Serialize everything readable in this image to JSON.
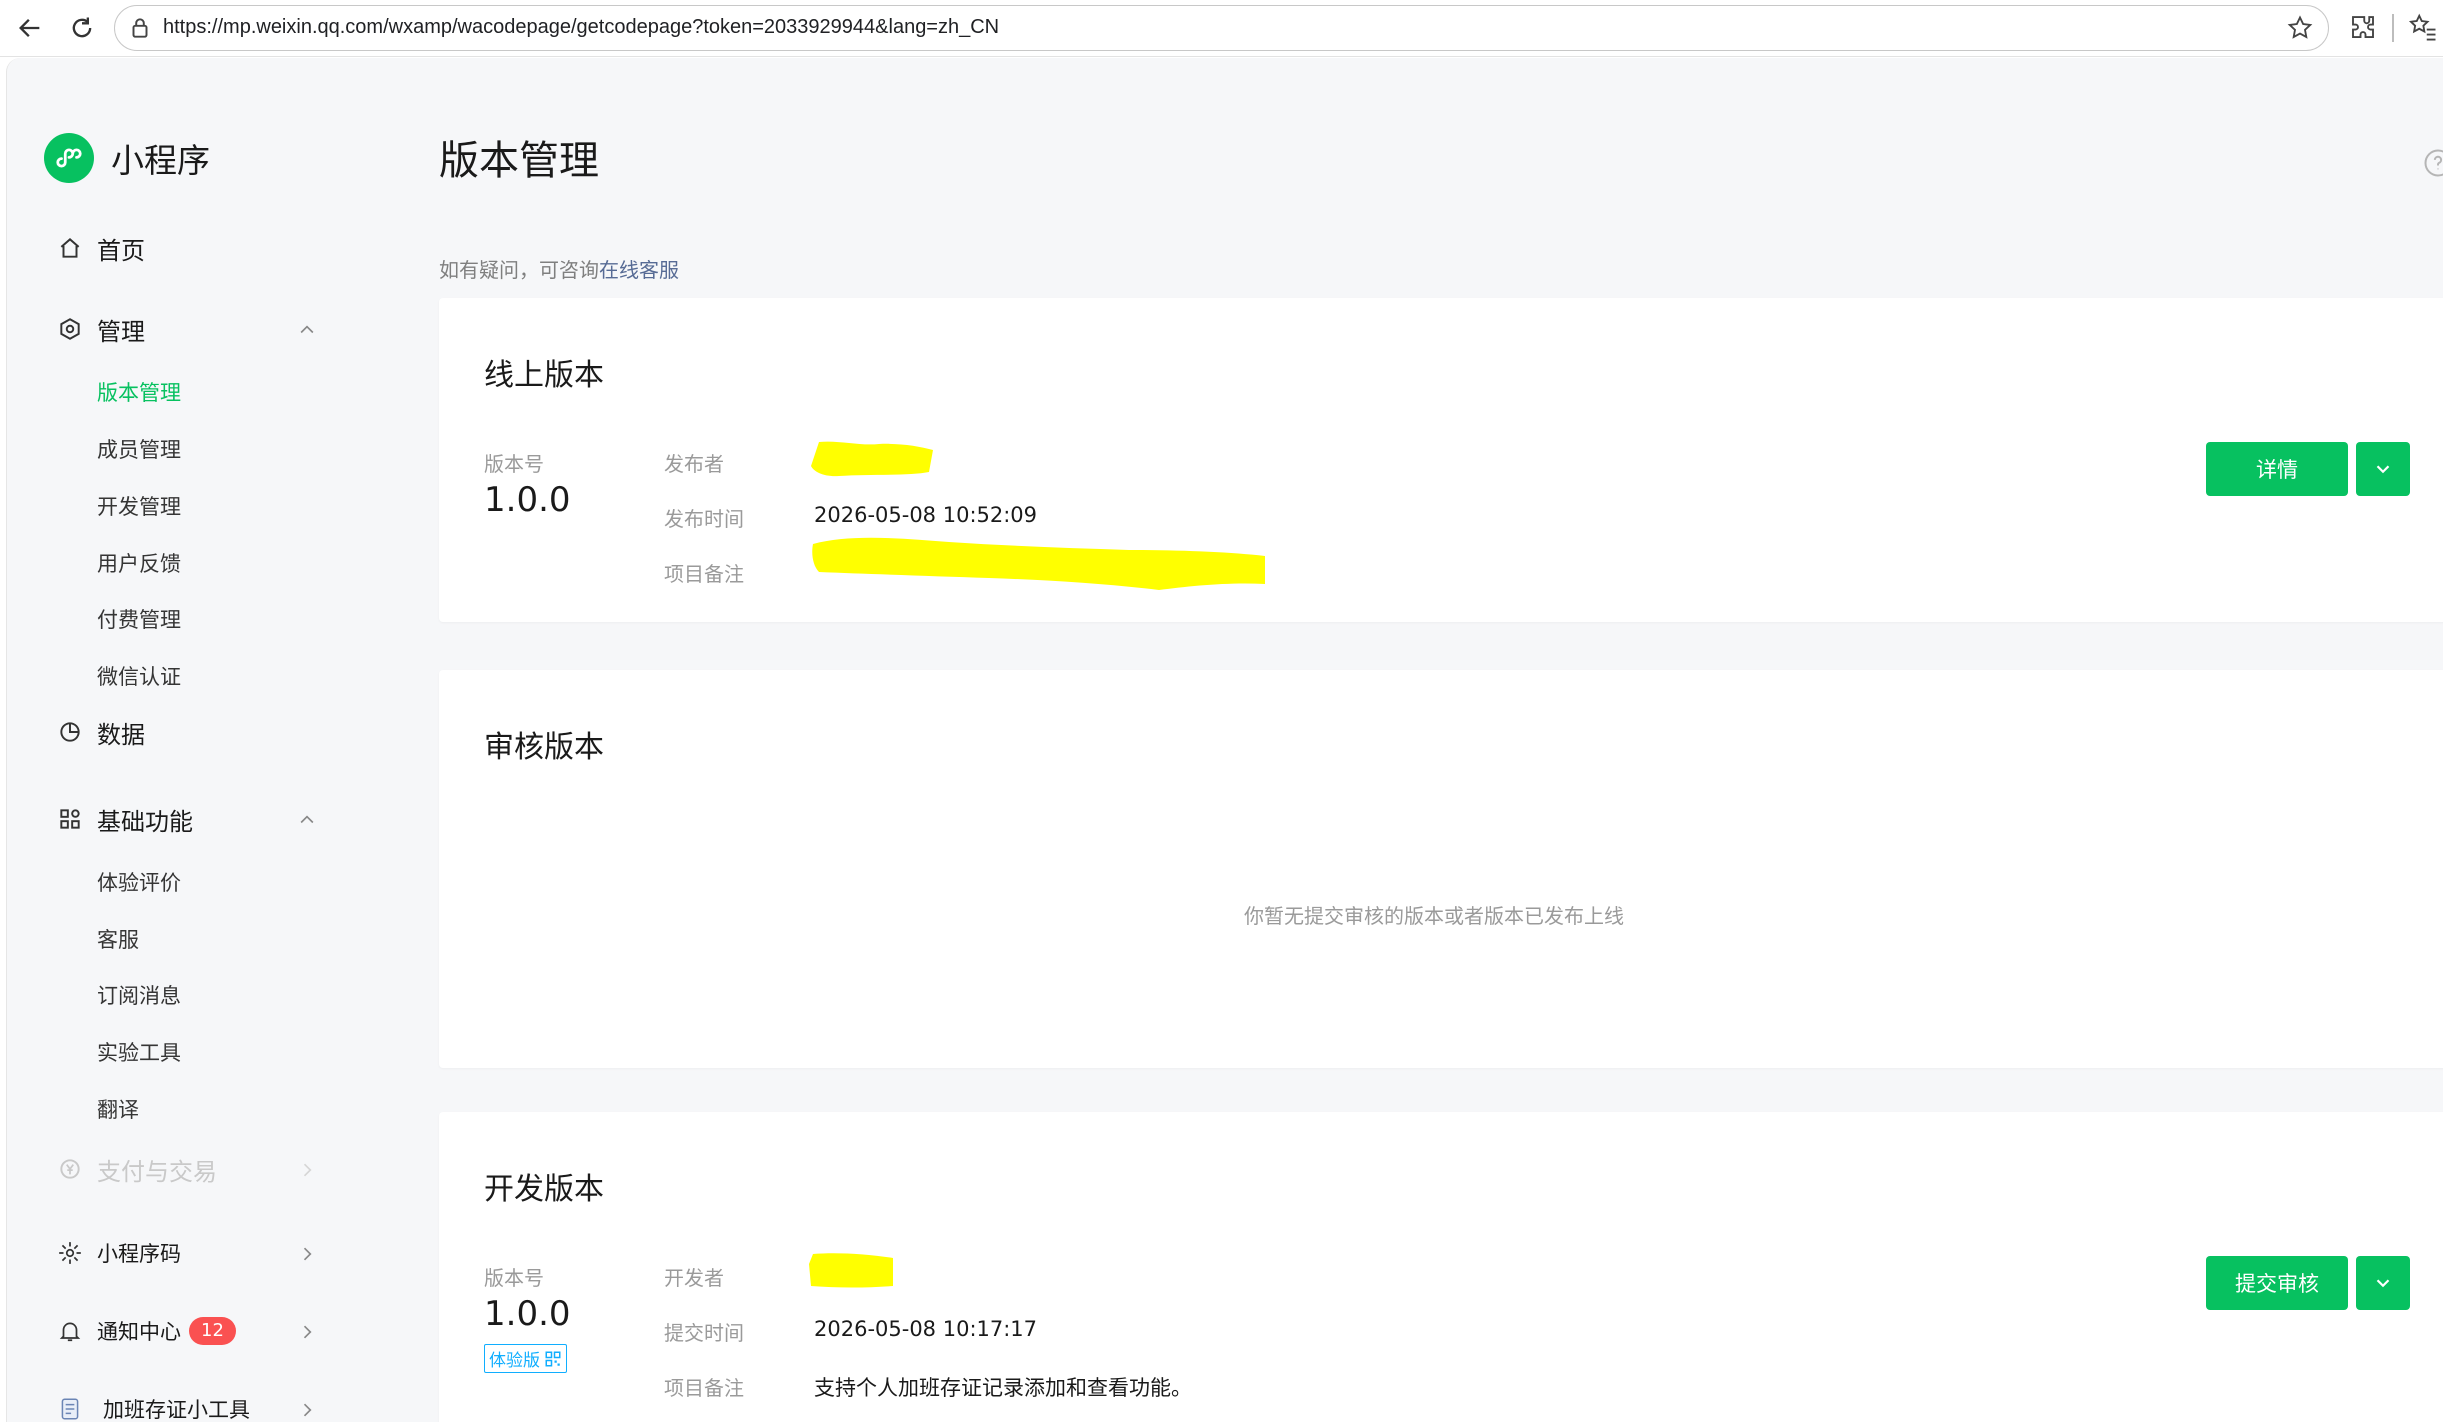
{
  "browser": {
    "url": "https://mp.weixin.qq.com/wxamp/wacodepage/getcodepage?token=2033929944&lang=zh_CN"
  },
  "sidebar": {
    "brand": "小程序",
    "home": "首页",
    "manage": {
      "label": "管理",
      "items": [
        {
          "label": "版本管理",
          "active": true
        },
        {
          "label": "成员管理"
        },
        {
          "label": "开发管理"
        },
        {
          "label": "用户反馈"
        },
        {
          "label": "付费管理"
        },
        {
          "label": "微信认证"
        }
      ]
    },
    "data": "数据",
    "basic": {
      "label": "基础功能",
      "items": [
        {
          "label": "体验评价"
        },
        {
          "label": "客服"
        },
        {
          "label": "订阅消息"
        },
        {
          "label": "实验工具"
        },
        {
          "label": "翻译"
        }
      ]
    },
    "payment": "支付与交易",
    "qrcode": "小程序码",
    "notify": {
      "label": "通知中心",
      "count": "12"
    },
    "app_name": "加班存证小工具"
  },
  "main": {
    "title": "版本管理",
    "tip_prefix": "如有疑问，可咨询",
    "tip_link": "在线客服",
    "online": {
      "title": "线上版本",
      "version_label": "版本号",
      "version": "1.0.0",
      "publisher_label": "发布者",
      "publish_time_label": "发布时间",
      "publish_time": "2026-05-08 10:52:09",
      "remark_label": "项目备注",
      "detail_btn": "详情"
    },
    "review": {
      "title": "审核版本",
      "empty": "你暂无提交审核的版本或者版本已发布上线"
    },
    "dev": {
      "title": "开发版本",
      "version_label": "版本号",
      "version": "1.0.0",
      "tag": "体验版",
      "developer_label": "开发者",
      "submit_time_label": "提交时间",
      "submit_time": "2026-05-08 10:17:17",
      "remark_label": "项目备注",
      "remark": "支持个人加班存证记录添加和查看功能。",
      "submit_btn": "提交审核"
    }
  },
  "colors": {
    "brand_green": "#07c160",
    "link": "#576b95",
    "badge_red": "#fa5151",
    "redaction_yellow": "#ffff00"
  }
}
